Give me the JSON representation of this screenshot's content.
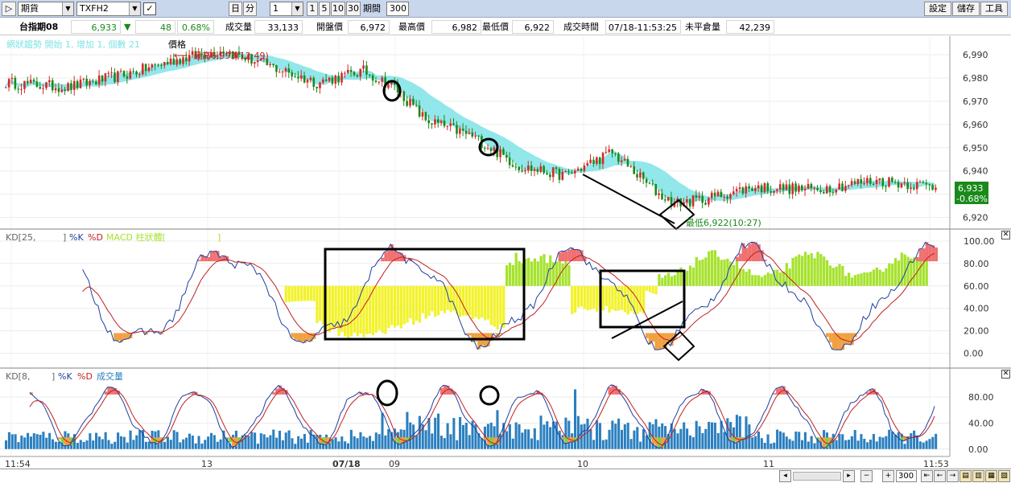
{
  "toolbar": {
    "market": "期貨",
    "symbol": "TXFH2",
    "period_day": "日",
    "period_min": "分",
    "interval_value": "1",
    "intervals": [
      "1",
      "5",
      "10",
      "30"
    ],
    "period_label": "期間",
    "period_value": "300",
    "buttons": [
      "設定",
      "儲存",
      "工具"
    ]
  },
  "quote": {
    "name": "台指期08",
    "last": "6,933",
    "change_arrow": "▼",
    "change": "48",
    "change_pct": "0.68%",
    "volume_label": "成交量",
    "volume": "33,133",
    "open_label": "開盤價",
    "open": "6,972",
    "high_label": "最高價",
    "high": "6,982",
    "low_label": "最低價",
    "low": "6,922",
    "time_label": "成交時間",
    "time": "07/18-11:53:25",
    "oi_label": "未平倉量",
    "oi": "42,239"
  },
  "main_panel": {
    "legend": "網狀趨勢 開始 1, 增加 1, 個數 21",
    "price_label": "價格",
    "high_note": "最高6,993(12:49)",
    "low_note": "最低6,922(10:27)",
    "last_price": "6,933",
    "last_pct": "-0.68%",
    "y_ticks": [
      "6,990",
      "6,980",
      "6,970",
      "6,960",
      "6,950",
      "6,940",
      "6,930",
      "6,920"
    ]
  },
  "kd_panel_1": {
    "legend_kd": "KD[25,",
    "legend_close": "]",
    "legend_k": "%K",
    "legend_d": "%D",
    "legend_macd": "MACD 柱狀體[",
    "legend_macd_close": "]",
    "y_ticks": [
      "100.00",
      "80.00",
      "60.00",
      "40.00",
      "20.00",
      "0.00"
    ]
  },
  "kd_panel_2": {
    "legend_kd": "KD[8,",
    "legend_close": "]",
    "legend_k": "%K",
    "legend_d": "%D",
    "legend_vol": "成交量",
    "y_ticks": [
      "80.00",
      "40.00",
      "0.00"
    ]
  },
  "x_axis": {
    "labels": [
      "11:54",
      "13",
      "07/18",
      "09",
      "10",
      "11",
      "11:53"
    ]
  },
  "bottom": {
    "zoom_value": "300"
  },
  "colors": {
    "up": "#d42a2a",
    "down": "#1a8a1a",
    "ribbon": "#7fe3e6",
    "k_line": "#2040a0",
    "d_line": "#c02020",
    "macd_pos": "#a6e22e",
    "macd_neg": "#f2f22a",
    "volume": "#2a7fbf"
  }
}
